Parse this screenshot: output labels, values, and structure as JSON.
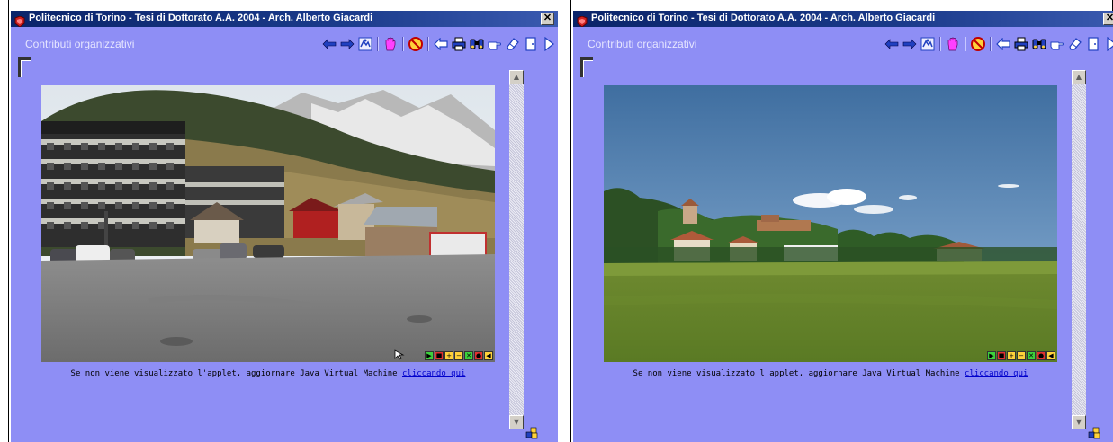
{
  "windows": [
    {
      "title": "Politecnico di Torino - Tesi di Dottorato A.A. 2004 - Arch. Alberto Giacardi",
      "close_glyph": "✕",
      "section": "Contributi organizzativi",
      "photo_subject": "parking-lot-mountain-village",
      "caption_text": "Se non viene visualizzato l'applet, aggiornare Java Virtual Machine ",
      "caption_link": "cliccando qui",
      "show_cursor": true
    },
    {
      "title": "Politecnico di Torino - Tesi di Dottorato A.A. 2004 - Arch. Alberto Giacardi",
      "close_glyph": "✕",
      "section": "Contributi organizzativi",
      "photo_subject": "green-meadow-hill-town",
      "caption_text": "Se non viene visualizzato l'applet, aggiornare Java Virtual Machine ",
      "caption_link": "cliccando qui",
      "show_cursor": false
    }
  ],
  "toolbar_icons": [
    "arrow-left-icon",
    "arrow-right-icon",
    "map-icon",
    "|",
    "hand-stop-icon",
    "|",
    "no-entry-icon",
    "|",
    "back-icon",
    "print-icon",
    "binoculars-icon",
    "pointing-hand-icon",
    "eraser-icon",
    "door-exit-icon",
    "play-next-icon"
  ],
  "player_controls": [
    {
      "name": "play-icon",
      "glyph": "▶",
      "bg": "#3cd03c"
    },
    {
      "name": "stop-icon",
      "glyph": "■",
      "bg": "#e03030"
    },
    {
      "name": "zoom-in-icon",
      "glyph": "+",
      "bg": "#ffd23a"
    },
    {
      "name": "zoom-out-icon",
      "glyph": "−",
      "bg": "#ffd23a"
    },
    {
      "name": "fullscreen-icon",
      "glyph": "✕",
      "bg": "#3cd03c"
    },
    {
      "name": "hotspot-icon",
      "glyph": "●",
      "bg": "#e03030"
    },
    {
      "name": "sound-icon",
      "glyph": "◀",
      "bg": "#ffd23a"
    }
  ],
  "colors": {
    "window_bg": "#8e8ef5",
    "titlebar": "#0a246a"
  }
}
